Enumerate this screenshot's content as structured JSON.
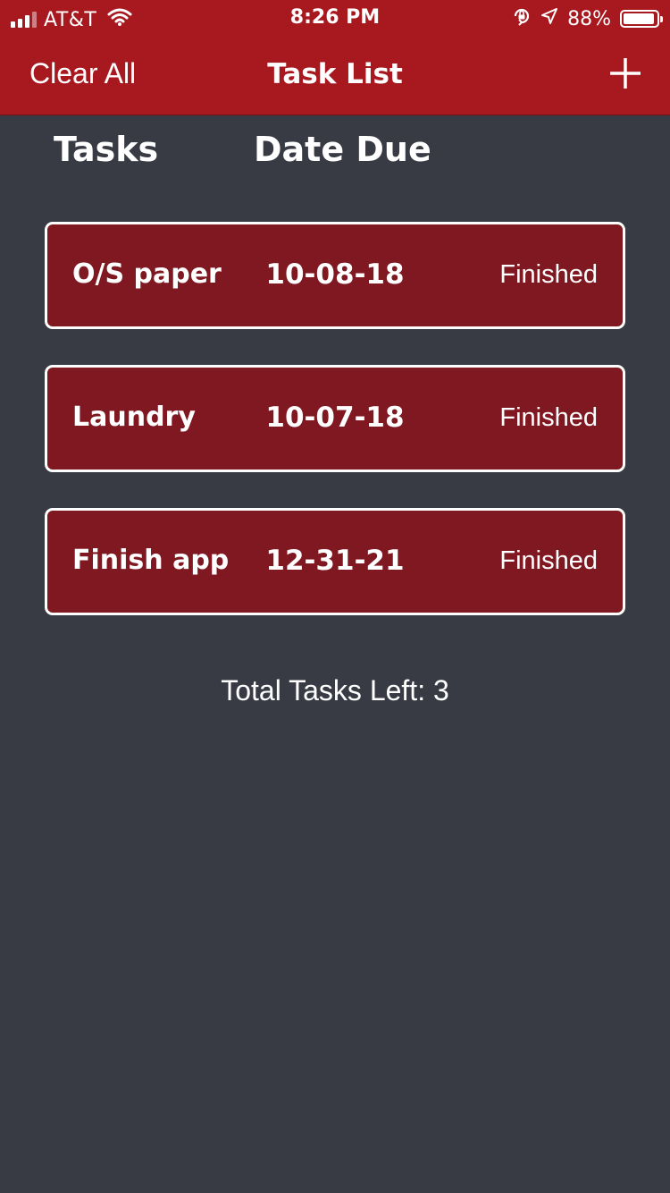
{
  "status_bar": {
    "carrier": "AT&T",
    "time": "8:26 PM",
    "battery": "88%",
    "signal_bars_filled": 3,
    "signal_bars_total": 4,
    "battery_level": 0.88,
    "icons": [
      "signal-icon",
      "wifi-icon",
      "orientation-lock-icon",
      "location-arrow-icon",
      "battery-icon"
    ]
  },
  "nav": {
    "left_button": "Clear All",
    "title": "Task List",
    "right_icon": "plus-icon"
  },
  "columns": {
    "tasks": "Tasks",
    "date_due": "Date Due"
  },
  "tasks": [
    {
      "name": "O/S paper",
      "date": "10-08-18",
      "status": "Finished"
    },
    {
      "name": "Laundry",
      "date": "10-07-18",
      "status": "Finished"
    },
    {
      "name": "Finish app",
      "date": "12-31-21",
      "status": "Finished"
    }
  ],
  "footer": {
    "total_label": "Total Tasks Left: 3"
  },
  "colors": {
    "header_red": "#a8181f",
    "card_red": "#7f1820",
    "background": "#383b44",
    "text": "#ffffff"
  }
}
